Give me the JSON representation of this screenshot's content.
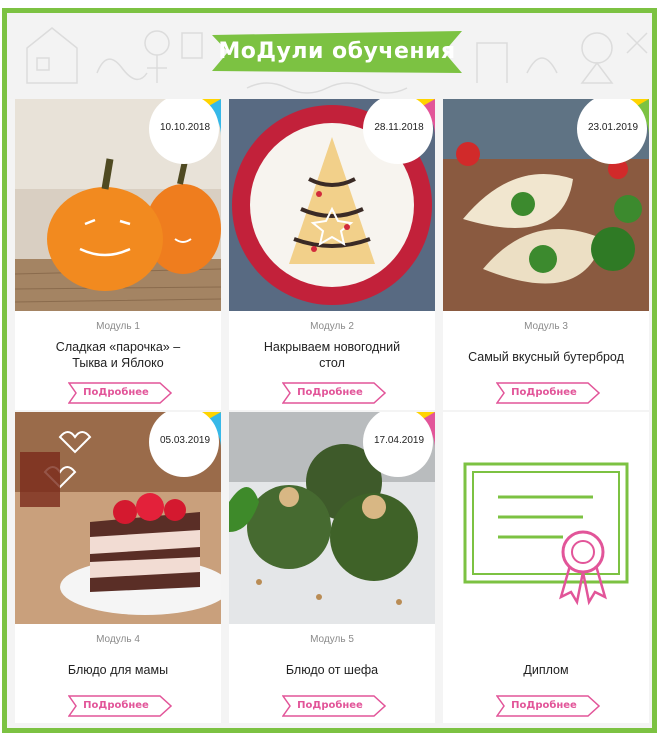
{
  "header": {
    "title": "МоДули обучения"
  },
  "colors": {
    "green": "#7cc242",
    "pink": "#e25599",
    "yellow": "#ffd400",
    "blue": "#36b8e8"
  },
  "modules": [
    {
      "label": "Модуль 1",
      "title_line1": "Сладкая «парочка» –",
      "title_line2": "Тыква и Яблоко",
      "date": "10.10.2018",
      "more": "ПоДробнее"
    },
    {
      "label": "Модуль 2",
      "title_line1": "Накрываем новогодний",
      "title_line2": "стол",
      "date": "28.11.2018",
      "more": "ПоДробнее"
    },
    {
      "label": "Модуль 3",
      "title_line1": "Самый вкусный бутерброд",
      "title_line2": "",
      "date": "23.01.2019",
      "more": "ПоДробнее"
    },
    {
      "label": "Модуль 4",
      "title_line1": "Блюдо для мамы",
      "title_line2": "",
      "date": "05.03.2019",
      "more": "ПоДробнее"
    },
    {
      "label": "Модуль 5",
      "title_line1": "Блюдо от шефа",
      "title_line2": "",
      "date": "17.04.2019",
      "more": "ПоДробнее"
    },
    {
      "label": "",
      "title_line1": "Диплом",
      "title_line2": "",
      "date": "",
      "more": "ПоДробнее"
    }
  ]
}
